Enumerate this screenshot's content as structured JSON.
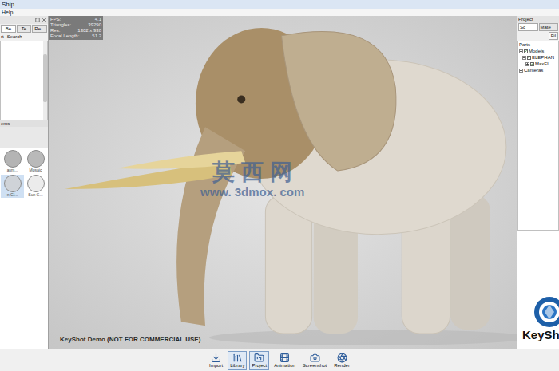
{
  "window": {
    "title": "Ship"
  },
  "menu": [
    "Help"
  ],
  "library_panel": {
    "tabs": [
      {
        "label": "Be",
        "selected": true
      },
      {
        "label": "Te",
        "selected": false
      },
      {
        "label": "Re...",
        "selected": false
      }
    ],
    "search_labels": [
      "rt",
      "Search"
    ],
    "list_footer": "ems",
    "materials": [
      {
        "label": "asm...",
        "selected": false,
        "color": "#b4b4b4"
      },
      {
        "label": "Mosaic",
        "selected": false,
        "color": "#b9b9b9"
      },
      {
        "label": "n Gl...",
        "selected": true,
        "color": "#cfd3d8"
      },
      {
        "label": "Sun G...",
        "selected": false,
        "color": "#ececec"
      }
    ]
  },
  "viewport": {
    "stats": [
      {
        "label": "FPS:",
        "value": "4.1"
      },
      {
        "label": "Triangles:",
        "value": "39290"
      },
      {
        "label": "Res:",
        "value": "1302 x 938"
      },
      {
        "label": "Focal Length:",
        "value": "51.2"
      }
    ],
    "watermark": {
      "title": "莫 西 网",
      "url": "www. 3dmox. com"
    },
    "demo_notice": "KeyShot Demo (NOT FOR COMMERCIAL USE)"
  },
  "project_panel": {
    "title": "Project",
    "tabs": [
      {
        "label": "Sc",
        "selected": true
      },
      {
        "label": "Mate",
        "selected": false
      }
    ],
    "filter_button": "Fil",
    "parts_label": "Parts",
    "tree": [
      {
        "label": "Models",
        "depth": 0,
        "kind": "checkable",
        "checked": true,
        "has_children": true,
        "expanded": true
      },
      {
        "label": "ELEPHAN",
        "depth": 1,
        "kind": "checkable",
        "checked": true,
        "has_children": true,
        "expanded": true
      },
      {
        "label": "MaxEl",
        "depth": 2,
        "kind": "checkable",
        "checked": true,
        "has_children": true,
        "expanded": false
      },
      {
        "label": "Cameras",
        "depth": 0,
        "kind": "plain",
        "checked": false,
        "has_children": true,
        "expanded": false
      }
    ],
    "logo_text": "KeySh"
  },
  "toolbar": [
    {
      "label": "Import",
      "selected": false
    },
    {
      "label": "Library",
      "selected": true
    },
    {
      "label": "Project",
      "selected": true
    },
    {
      "label": "Animation",
      "selected": false
    },
    {
      "label": "Screenshot",
      "selected": false
    },
    {
      "label": "Render",
      "selected": false
    }
  ]
}
